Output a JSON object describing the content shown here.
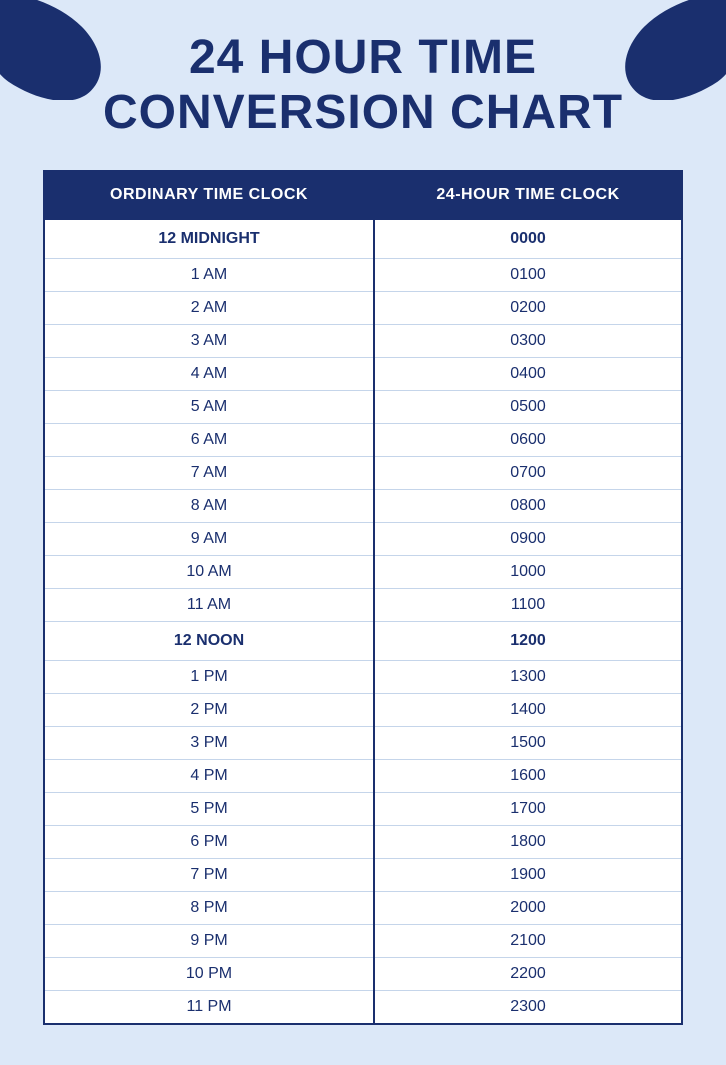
{
  "page": {
    "background_color": "#dce8f8",
    "title_line1": "24 HOUR TIME",
    "title_line2": "CONVERSION CHART",
    "title_color": "#1a2f6e"
  },
  "table": {
    "header": {
      "col1": "ORDINARY TIME CLOCK",
      "col2": "24-HOUR TIME CLOCK"
    },
    "rows": [
      {
        "ordinary": "12 MIDNIGHT",
        "military": "0000",
        "special": true
      },
      {
        "ordinary": "1 AM",
        "military": "0100",
        "special": false
      },
      {
        "ordinary": "2 AM",
        "military": "0200",
        "special": false
      },
      {
        "ordinary": "3 AM",
        "military": "0300",
        "special": false
      },
      {
        "ordinary": "4 AM",
        "military": "0400",
        "special": false
      },
      {
        "ordinary": "5 AM",
        "military": "0500",
        "special": false
      },
      {
        "ordinary": "6 AM",
        "military": "0600",
        "special": false
      },
      {
        "ordinary": "7 AM",
        "military": "0700",
        "special": false
      },
      {
        "ordinary": "8 AM",
        "military": "0800",
        "special": false
      },
      {
        "ordinary": "9 AM",
        "military": "0900",
        "special": false
      },
      {
        "ordinary": "10 AM",
        "military": "1000",
        "special": false
      },
      {
        "ordinary": "11 AM",
        "military": "1100",
        "special": false
      },
      {
        "ordinary": "12 NOON",
        "military": "1200",
        "special": true
      },
      {
        "ordinary": "1 PM",
        "military": "1300",
        "special": false
      },
      {
        "ordinary": "2 PM",
        "military": "1400",
        "special": false
      },
      {
        "ordinary": "3 PM",
        "military": "1500",
        "special": false
      },
      {
        "ordinary": "4 PM",
        "military": "1600",
        "special": false
      },
      {
        "ordinary": "5 PM",
        "military": "1700",
        "special": false
      },
      {
        "ordinary": "6 PM",
        "military": "1800",
        "special": false
      },
      {
        "ordinary": "7 PM",
        "military": "1900",
        "special": false
      },
      {
        "ordinary": "8 PM",
        "military": "2000",
        "special": false
      },
      {
        "ordinary": "9 PM",
        "military": "2100",
        "special": false
      },
      {
        "ordinary": "10 PM",
        "military": "2200",
        "special": false
      },
      {
        "ordinary": "11 PM",
        "military": "2300",
        "special": false
      }
    ]
  },
  "decorations": {
    "blob_color": "#1a2f6e"
  }
}
